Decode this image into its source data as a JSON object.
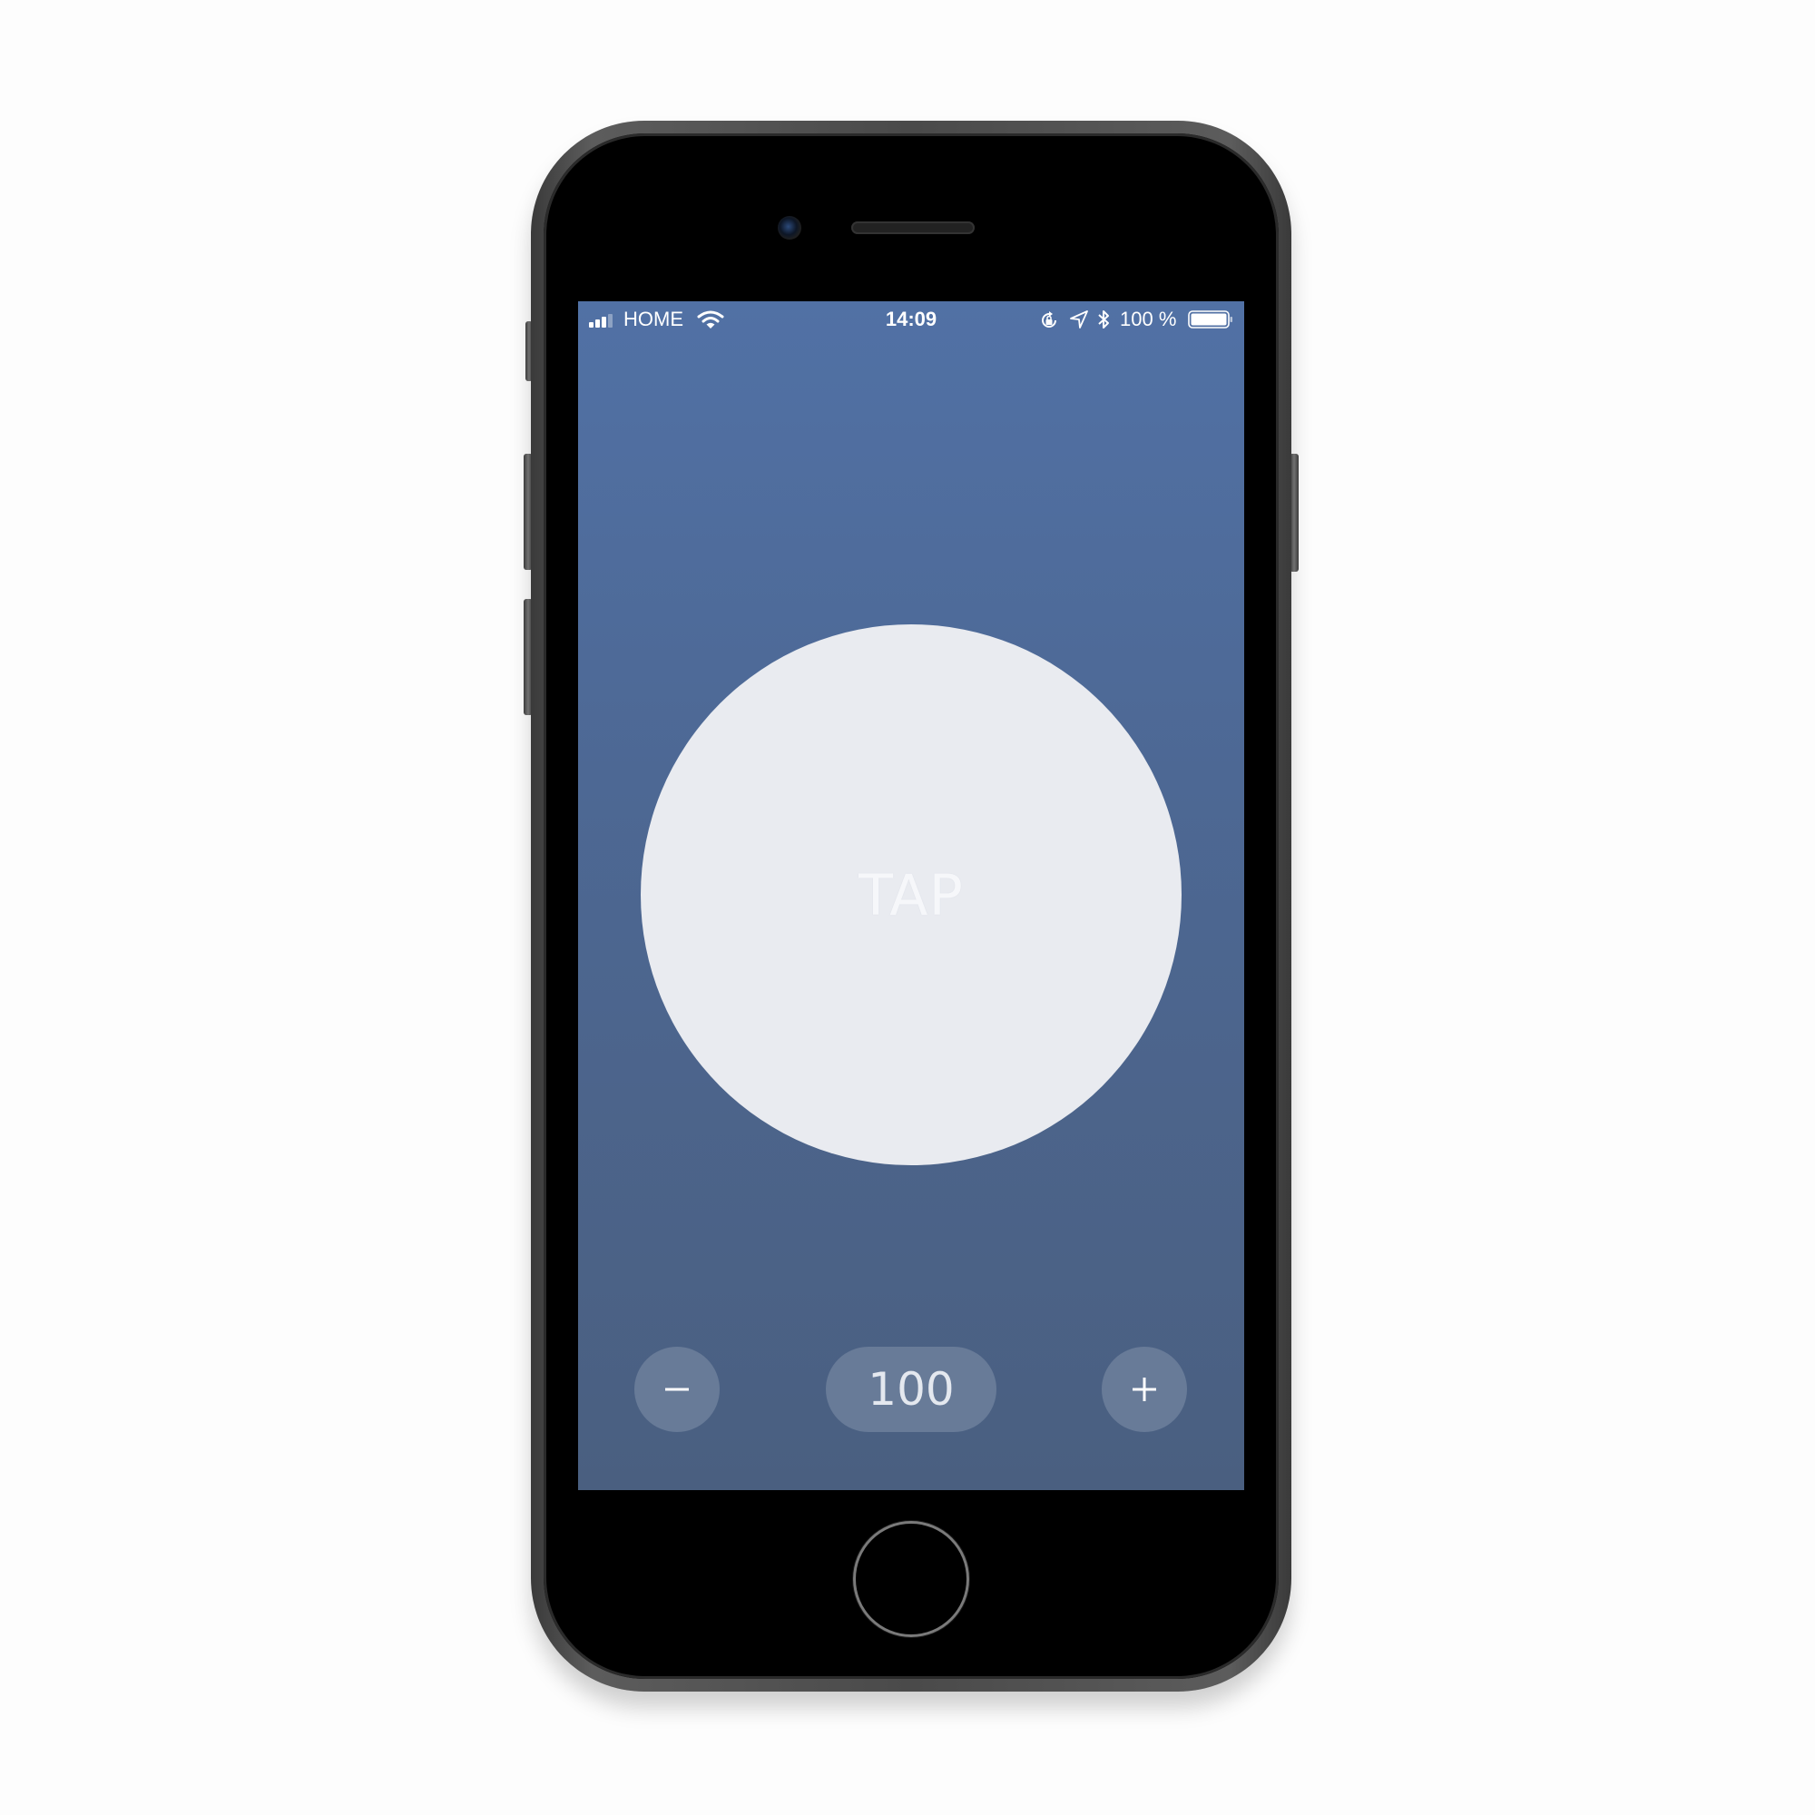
{
  "status_bar": {
    "carrier": "HOME",
    "time": "14:09",
    "battery_percent": "100 %",
    "signal_bars": 3,
    "icons": [
      "signal-icon",
      "wifi-icon",
      "rotation-lock-icon",
      "location-arrow-icon",
      "bluetooth-icon",
      "battery-icon"
    ]
  },
  "main": {
    "tap_label": "TAP"
  },
  "counter": {
    "value": "100",
    "minus_icon": "minus-icon",
    "plus_icon": "plus-icon"
  },
  "colors": {
    "screen_top": "#5171a5",
    "screen_bottom": "#4a5f80",
    "tap_circle": "#e9ebf0",
    "control_bg": "#687b98"
  }
}
